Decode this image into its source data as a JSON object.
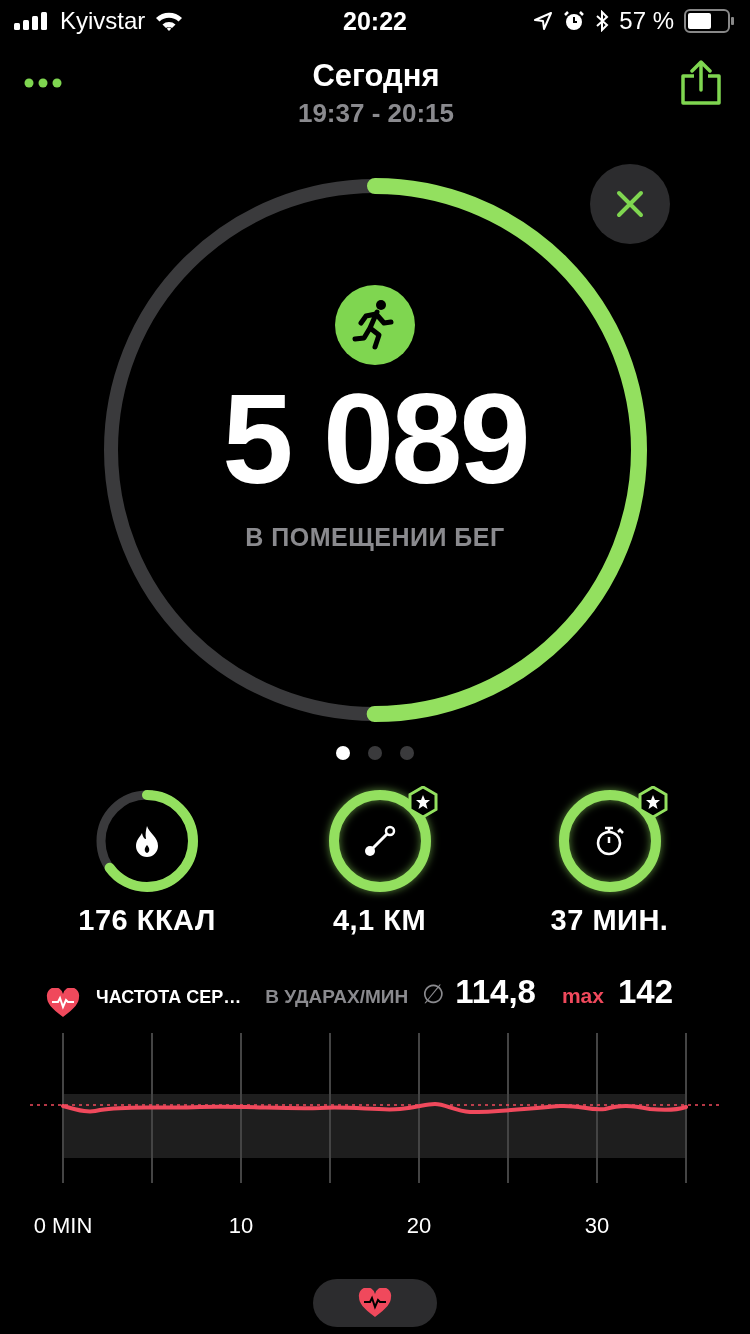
{
  "status_bar": {
    "carrier": "Kyivstar",
    "time": "20:22",
    "battery": "57 %"
  },
  "header": {
    "title": "Сегодня",
    "time_range": "19:37 - 20:15"
  },
  "workout": {
    "value": "5 089",
    "label": "В ПОМЕЩЕНИИ БЕГ"
  },
  "page_dots": [
    {
      "selected": true
    },
    {
      "selected": false
    },
    {
      "selected": false
    }
  ],
  "metrics": [
    {
      "kind": "calories",
      "value": "176 ККАЛ",
      "badge": false
    },
    {
      "kind": "distance",
      "value": "4,1 КМ",
      "badge": true
    },
    {
      "kind": "duration",
      "value": "37 МИН.",
      "badge": true
    }
  ],
  "heart_rate": {
    "title": "ЧАСТОТА СЕР…",
    "unit": "В УДАРАХ/МИН",
    "avg_symbol": "∅",
    "average": "114,8",
    "max_label": "max",
    "max": "142",
    "x_labels": [
      "0 MIN",
      "10",
      "20",
      "30"
    ]
  }
}
